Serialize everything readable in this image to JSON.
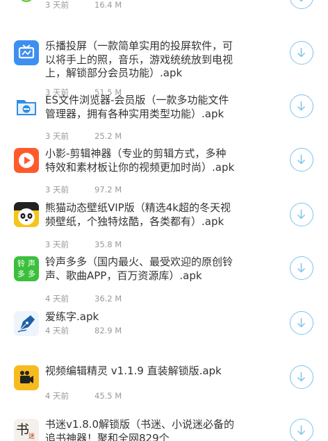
{
  "items": [
    {
      "title": "",
      "date": "3 天前",
      "size": "16.4 M",
      "icon": "green-app-icon"
    },
    {
      "title": "乐播投屏（一款简单实用的投屏软件，可以将手上的照，音乐，游戏统统放到电视上，解锁部分会员功能）.apk",
      "date": "3 天前",
      "size": "51.5 M",
      "icon": "tv-cast-icon"
    },
    {
      "title": "ES文件浏览器-会员版（一款多功能文件管理器，拥有各种实用类型功能）.apk",
      "date": "3 天前",
      "size": "25.2 M",
      "icon": "es-file-icon"
    },
    {
      "title": "小影-剪辑神器（专业的剪辑方式，多种特效和素材板让你的视频更加时尚）.apk",
      "date": "3 天前",
      "size": "97.2 M",
      "icon": "video-play-icon"
    },
    {
      "title": "熊猫动态壁纸VIP版（精选4k超的冬天视频壁纸，个独特炫酷，各类都有）.apk",
      "date": "3 天前",
      "size": "35.8 M",
      "icon": "panda-icon"
    },
    {
      "title": "铃声多多（国内最火、最受欢迎的原创铃声、歌曲APP，百万资源库）.apk",
      "date": "4 天前",
      "size": "36.2 M",
      "icon": "ringtone-icon",
      "icon_text": [
        "铃",
        "声",
        "多",
        "多"
      ]
    },
    {
      "title": "爱练字.apk",
      "date": "4 天前",
      "size": "82.9 M",
      "icon": "pen-nib-icon"
    },
    {
      "title": "视频编辑精灵 v1.1.9 直装解锁版.apk",
      "date": "4 天前",
      "size": "45.5 M",
      "icon": "video-editor-icon"
    },
    {
      "title": "书迷v1.8.0解锁版（书迷、小说迷必备的追书神器！聚和全网829个",
      "date": "",
      "size": "",
      "icon": "book-icon",
      "icon_text": [
        "书",
        "迷"
      ]
    }
  ],
  "download_icon": "download-arrow-icon",
  "colors": {
    "title": "#333333",
    "meta": "#999999",
    "download_ring": "#7cc3ee"
  }
}
